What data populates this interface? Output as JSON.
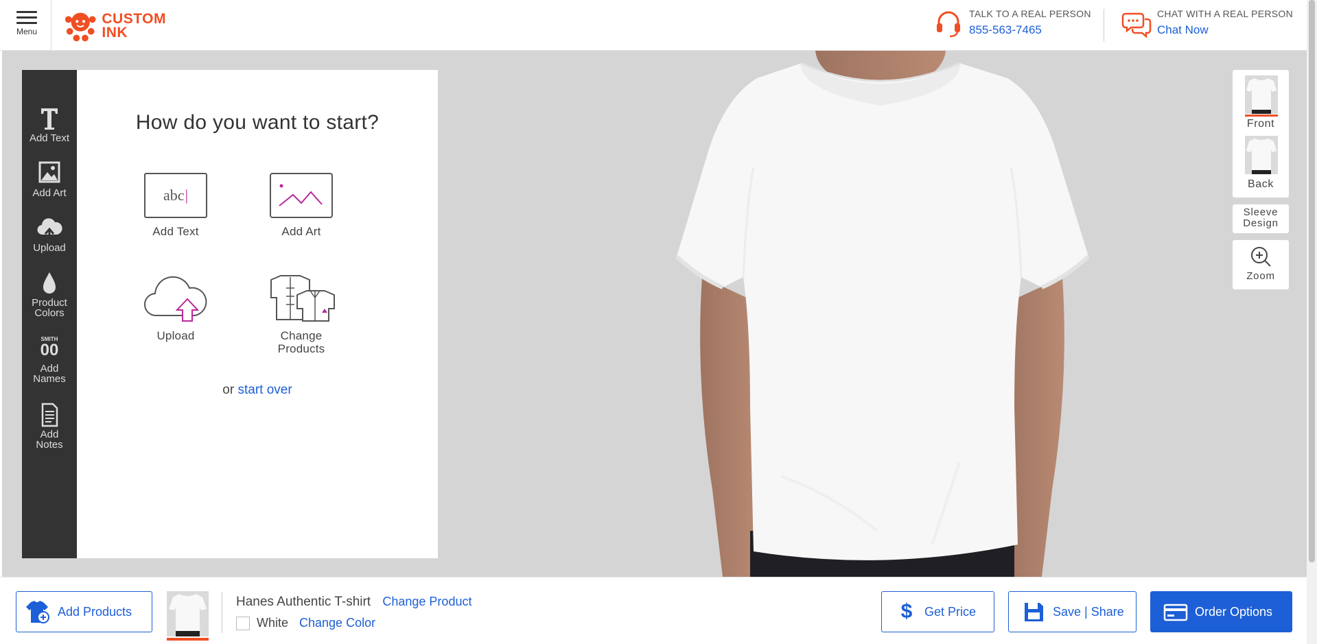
{
  "header": {
    "menu_label": "Menu",
    "logo_line1": "CUSTOM",
    "logo_line2": "INK",
    "phone": {
      "label": "TALK TO A REAL PERSON",
      "value": "855-563-7465"
    },
    "chat": {
      "label": "CHAT WITH A REAL PERSON",
      "link": "Chat Now"
    }
  },
  "rail": {
    "items": [
      {
        "label": "Add Text",
        "icon": "text-t-icon"
      },
      {
        "label": "Add Art",
        "icon": "image-icon"
      },
      {
        "label": "Upload",
        "icon": "cloud-upload-icon"
      },
      {
        "label": "Product\nColors",
        "icon": "paint-drop-icon"
      },
      {
        "label": "Add\nNames",
        "icon": "names-numbers-icon",
        "icon_text": "SMITH",
        "icon_digits": "00"
      },
      {
        "label": "Add\nNotes",
        "icon": "notes-icon"
      }
    ]
  },
  "start": {
    "title": "How do you want to start?",
    "options": [
      {
        "label": "Add Text",
        "icon_text": "abc"
      },
      {
        "label": "Add Art"
      },
      {
        "label": "Upload"
      },
      {
        "label": "Change\nProducts"
      }
    ],
    "or_text": "or ",
    "start_over": "start over"
  },
  "views": {
    "front": "Front",
    "back": "Back",
    "sleeve": "Sleeve\nDesign",
    "zoom": "Zoom"
  },
  "bottom": {
    "add_products": "Add Products",
    "product_name": "Hanes Authentic T-shirt",
    "change_product": "Change Product",
    "color_name": "White",
    "change_color": "Change Color",
    "get_price": "Get Price",
    "save_share": "Save | Share",
    "order_options": "Order Options"
  },
  "colors": {
    "brand_orange": "#f04e23",
    "link_blue": "#1d5fd6",
    "rail_dark": "#333333",
    "stage_gray": "#d5d5d5",
    "accent_purple": "#b8289a"
  }
}
